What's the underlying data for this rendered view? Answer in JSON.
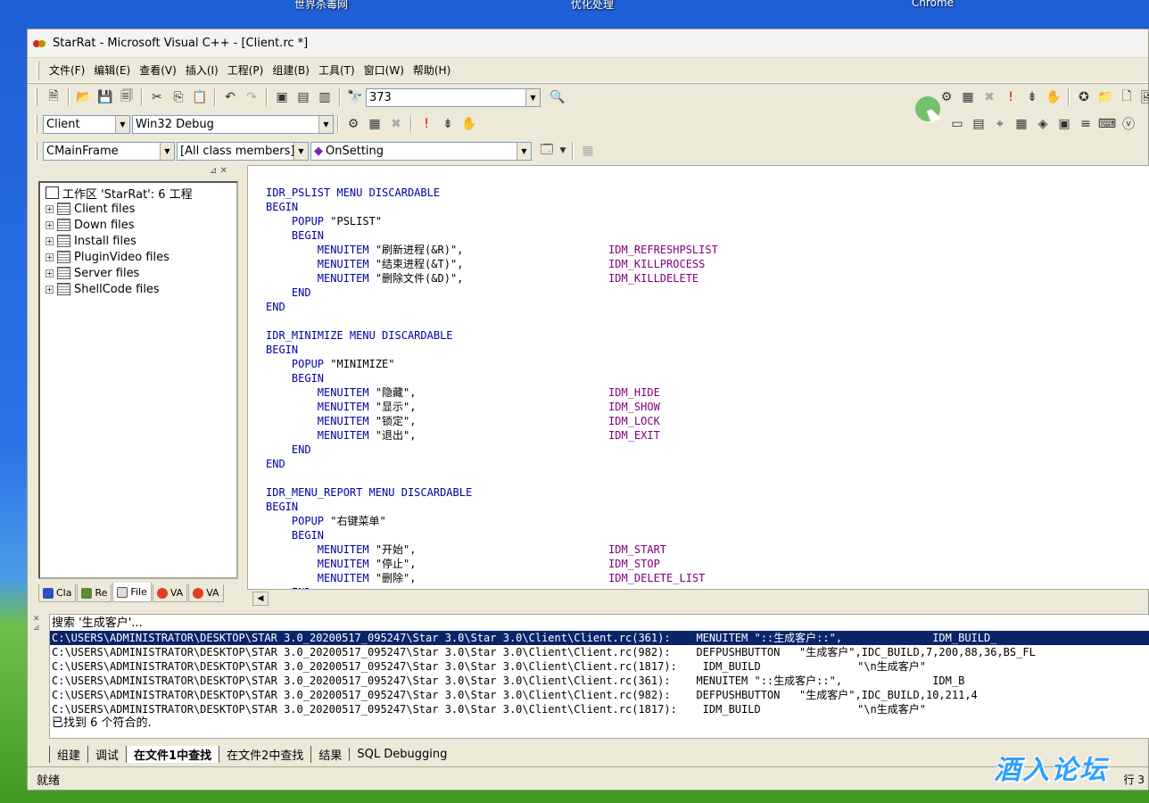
{
  "desktop": {
    "labels": [
      "世界杀毒网",
      "优化处理",
      "Chrome"
    ],
    "watermark": "酒入论坛"
  },
  "window": {
    "title": "StarRat - Microsoft Visual C++ - [Client.rc *]"
  },
  "menu": [
    "文件(F)",
    "编辑(E)",
    "查看(V)",
    "插入(I)",
    "工程(P)",
    "组建(B)",
    "工具(T)",
    "窗口(W)",
    "帮助(H)"
  ],
  "toolbar": {
    "find_value": "373",
    "project": "Client",
    "config": "Win32 Debug",
    "class": "CMainFrame",
    "filter": "[All class members]",
    "member": "OnSetting"
  },
  "workspace": {
    "root": "工作区 'StarRat': 6 工程",
    "items": [
      "Client files",
      "Down files",
      "Install files",
      "PluginVideo files",
      "Server files",
      "ShellCode files"
    ],
    "tabs": [
      "Cla",
      "Re",
      "File",
      "VA",
      "VA"
    ]
  },
  "editor": {
    "lines": [
      [
        {
          "t": "IDR_PSLIST MENU DISCARDABLE",
          "c": "kw"
        }
      ],
      [
        {
          "t": "BEGIN",
          "c": "kw"
        }
      ],
      [
        {
          "t": "    POPUP ",
          "c": "kw"
        },
        {
          "t": "\"PSLIST\"",
          "c": "str"
        }
      ],
      [
        {
          "t": "    BEGIN",
          "c": "kw"
        }
      ],
      [
        {
          "t": "        MENUITEM ",
          "c": "kw"
        },
        {
          "t": "\"刷新进程(&R)\",",
          "c": "str"
        },
        {
          "t": "IDM_REFRESHPSLIST",
          "c": "id",
          "col": 48
        }
      ],
      [
        {
          "t": "        MENUITEM ",
          "c": "kw"
        },
        {
          "t": "\"结束进程(&T)\",",
          "c": "str"
        },
        {
          "t": "IDM_KILLPROCESS",
          "c": "id",
          "col": 48
        }
      ],
      [
        {
          "t": "        MENUITEM ",
          "c": "kw"
        },
        {
          "t": "\"删除文件(&D)\",",
          "c": "str"
        },
        {
          "t": "IDM_KILLDELETE",
          "c": "id",
          "col": 48
        }
      ],
      [
        {
          "t": "    END",
          "c": "kw"
        }
      ],
      [
        {
          "t": "END",
          "c": "kw"
        }
      ],
      [],
      [
        {
          "t": "IDR_MINIMIZE MENU DISCARDABLE",
          "c": "kw"
        }
      ],
      [
        {
          "t": "BEGIN",
          "c": "kw"
        }
      ],
      [
        {
          "t": "    POPUP ",
          "c": "kw"
        },
        {
          "t": "\"MINIMIZE\"",
          "c": "str"
        }
      ],
      [
        {
          "t": "    BEGIN",
          "c": "kw"
        }
      ],
      [
        {
          "t": "        MENUITEM ",
          "c": "kw"
        },
        {
          "t": "\"隐藏\",",
          "c": "str"
        },
        {
          "t": "IDM_HIDE",
          "c": "id",
          "col": 48
        }
      ],
      [
        {
          "t": "        MENUITEM ",
          "c": "kw"
        },
        {
          "t": "\"显示\",",
          "c": "str"
        },
        {
          "t": "IDM_SHOW",
          "c": "id",
          "col": 48
        }
      ],
      [
        {
          "t": "        MENUITEM ",
          "c": "kw"
        },
        {
          "t": "\"锁定\",",
          "c": "str"
        },
        {
          "t": "IDM_LOCK",
          "c": "id",
          "col": 48
        }
      ],
      [
        {
          "t": "        MENUITEM ",
          "c": "kw"
        },
        {
          "t": "\"退出\",",
          "c": "str"
        },
        {
          "t": "IDM_EXIT",
          "c": "id",
          "col": 48
        }
      ],
      [
        {
          "t": "    END",
          "c": "kw"
        }
      ],
      [
        {
          "t": "END",
          "c": "kw"
        }
      ],
      [],
      [
        {
          "t": "IDR_MENU_REPORT MENU DISCARDABLE",
          "c": "kw"
        }
      ],
      [
        {
          "t": "BEGIN",
          "c": "kw"
        }
      ],
      [
        {
          "t": "    POPUP ",
          "c": "kw"
        },
        {
          "t": "\"右键菜单\"",
          "c": "str"
        }
      ],
      [
        {
          "t": "    BEGIN",
          "c": "kw"
        }
      ],
      [
        {
          "t": "        MENUITEM ",
          "c": "kw"
        },
        {
          "t": "\"开始\",",
          "c": "str"
        },
        {
          "t": "IDM_START",
          "c": "id",
          "col": 48
        }
      ],
      [
        {
          "t": "        MENUITEM ",
          "c": "kw"
        },
        {
          "t": "\"停止\",",
          "c": "str"
        },
        {
          "t": "IDM_STOP",
          "c": "id",
          "col": 48
        }
      ],
      [
        {
          "t": "        MENUITEM ",
          "c": "kw"
        },
        {
          "t": "\"删除\",",
          "c": "str"
        },
        {
          "t": "IDM_DELETE_LIST",
          "c": "id",
          "col": 48
        }
      ],
      [
        {
          "t": "    END",
          "c": "kw"
        }
      ]
    ]
  },
  "output": {
    "header": "搜索 '生成客户'...",
    "lines": [
      "C:\\USERS\\ADMINISTRATOR\\DESKTOP\\STAR 3.0_20200517_095247\\Star 3.0\\Star 3.0\\Client\\Client.rc(361):    MENUITEM \"::生成客户::\",              IDM_BUILD_",
      "C:\\USERS\\ADMINISTRATOR\\DESKTOP\\STAR 3.0_20200517_095247\\Star 3.0\\Star 3.0\\Client\\Client.rc(982):    DEFPUSHBUTTON   \"生成客户\",IDC_BUILD,7,200,88,36,BS_FL",
      "C:\\USERS\\ADMINISTRATOR\\DESKTOP\\STAR 3.0_20200517_095247\\Star 3.0\\Star 3.0\\Client\\Client.rc(1817):    IDM_BUILD               \"\\n生成客户\"",
      "C:\\USERS\\ADMINISTRATOR\\DESKTOP\\STAR 3.0_20200517_095247\\Star 3.0\\Star 3.0\\Client\\Client.rc(361):    MENUITEM \"::生成客户::\",              IDM_B",
      "C:\\USERS\\ADMINISTRATOR\\DESKTOP\\STAR 3.0_20200517_095247\\Star 3.0\\Star 3.0\\Client\\Client.rc(982):    DEFPUSHBUTTON   \"生成客户\",IDC_BUILD,10,211,4",
      "C:\\USERS\\ADMINISTRATOR\\DESKTOP\\STAR 3.0_20200517_095247\\Star 3.0\\Star 3.0\\Client\\Client.rc(1817):    IDM_BUILD               \"\\n生成客户\""
    ],
    "footer": "已找到 6 个符合的.",
    "tabs": [
      "组建",
      "调试",
      "在文件1中查找",
      "在文件2中查找",
      "结果",
      "SQL Debugging"
    ],
    "active_tab": 2
  },
  "status": {
    "left": "就绪",
    "right": "行 3"
  }
}
